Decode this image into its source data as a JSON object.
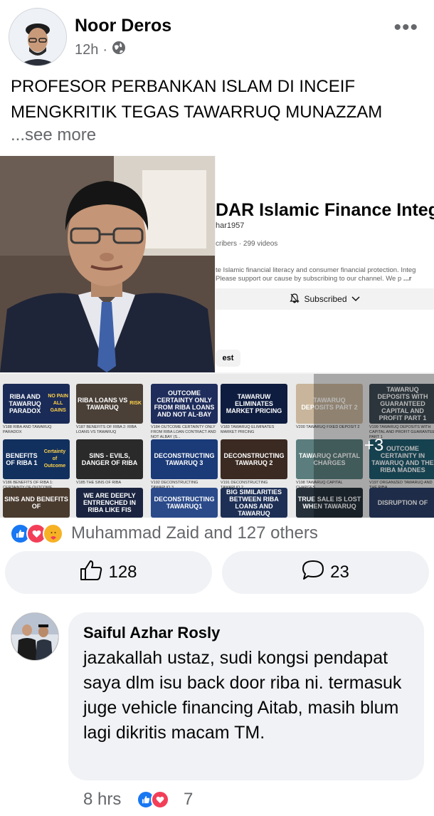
{
  "post": {
    "author": "Noor Deros",
    "time": "12h",
    "separator": "·",
    "more": "•••",
    "text": "PROFESOR PERBANKAN ISLAM DI INCEIF MENGKRITIK TEGAS TAWARRUQ MUNAZZAM",
    "see_more": "...see more"
  },
  "media": {
    "channel_title": "DAR Islamic Finance Integ",
    "channel_handle": "har1957",
    "channel_stats": "cribers · 299 videos",
    "channel_desc_1": "te Islamic financial literacy and consumer financial protection. Integ",
    "channel_desc_2": "Please support our cause by subscribing to our channel. We p",
    "channel_desc_more": "...r",
    "subscribed_label": "Subscribed",
    "chip_label": "est",
    "more_count": "+3",
    "thumbs": [
      {
        "title": "RIBA AND TAWARUQ PARADOX",
        "sub": "NO PAIN ALL GAINS",
        "caption": "V188 RIBA AND TAWARUQ PARADOX",
        "color": "#1b2b57"
      },
      {
        "title": "RIBA LOANS VS TAWARUQ",
        "sub": "RISK",
        "caption": "V187 BENEFITS OF RIBA 2: RIBA LOANS VS TAWARUQ",
        "color": "#4a4038"
      },
      {
        "title": "OUTCOME CERTAINTY ONLY FROM RIBA LOANS AND NOT AL-BAY",
        "sub": "",
        "caption": "V184 OUTCOME CERTAINTY ONLY FROM RIBA LOAN CONTRACT AND NOT ALBAY (S...",
        "color": "#1f2d5c"
      },
      {
        "title": "TAWARUW ELIMINATES MARKET PRICING",
        "sub": "",
        "caption": "V183 TAWARUQ ELIMINATES MARKET PRICING",
        "color": "#0e1c3f"
      },
      {
        "title": "TAWARUQ DEPOSITS PART 2",
        "sub": "",
        "caption": "V200 TAWARUQ FIXED DEPOSIT 2",
        "color": "#c8b59b"
      },
      {
        "title": "TAWARUQ DEPOSITS WITH GUARANTEED CAPITAL AND PROFIT PART 1",
        "sub": "",
        "caption": "V199 TAWARUQ DEPOSITS WITH CAPITAL AND PROFIT GUARANTEE PART 1",
        "color": "#3d4a52"
      },
      {
        "title": "BENEFITS OF RIBA 1",
        "sub": "Certainty of Outcome",
        "caption": "V186 BENEFITS OF RIBA 1: CERTAINTY OF OUTCOME",
        "color": "#12305e"
      },
      {
        "title": "SINS - EVILS, DANGER OF RIBA",
        "sub": "",
        "caption": "V185 THE SINS OF RIBA",
        "color": "#2a2a2a"
      },
      {
        "title": "DECONSTRUCTING TAWARUQ 3",
        "sub": "",
        "caption": "V192 DECONSTRUCTING TAWARUQ 3",
        "color": "#1b3a78"
      },
      {
        "title": "DECONSTRUCTING TAWARUQ 2",
        "sub": "",
        "caption": "V191 DECONSTRUCTING TAWARUQ 2",
        "color": "#3b2a22"
      },
      {
        "title": "TAWARUQ CAPITAL CHARGES",
        "sub": "",
        "caption": "V198 TAWARUQ CAPITAL CHARGES",
        "color": "#5b7d7d"
      },
      {
        "title": "OUTCOME CERTAINTY IN TAWARUQ AND THE RIBA MADNES",
        "sub": "",
        "caption": "V197 ORGANIZED TAWARUQ AND THE RIBA",
        "color": "#1f5a6e"
      },
      {
        "title": "SINS AND BENEFITS OF",
        "sub": "",
        "caption": "",
        "color": "#4a3b2f"
      },
      {
        "title": "WE ARE DEEPLY ENTRENCHED IN RIBA LIKE FIS",
        "sub": "",
        "caption": "",
        "color": "#1a2440"
      },
      {
        "title": "DECONSTRUCTING TAWARUQ1",
        "sub": "",
        "caption": "",
        "color": "#2a4a8a"
      },
      {
        "title": "BIG SIMILARITIES BETWEEN RIBA LOANS AND TAWARUQ",
        "sub": "",
        "caption": "",
        "color": "#1d2f55"
      },
      {
        "title": "TRUE SALE IS LOST WHEN TAWARUQ",
        "sub": "",
        "caption": "",
        "color": "#25303a"
      },
      {
        "title": "DISRUPTION OF",
        "sub": "",
        "caption": "",
        "color": "#2a3d66"
      }
    ]
  },
  "reactions": {
    "summary": "Muhammad Zaid and 127 others",
    "icons": [
      "like-icon",
      "love-icon",
      "care-icon"
    ],
    "colors": {
      "like": "#1877f2",
      "love": "#f33e58",
      "care": "#f7b125"
    }
  },
  "actions": {
    "like_count": "128",
    "comment_count": "23"
  },
  "comment": {
    "author": "Saiful Azhar Rosly",
    "text": "jazakallah ustaz, sudi kongsi pendapat saya dlm isu back door riba ni. termasuk juge vehicle financing Aitab, masih blum lagi dikritis macam TM.",
    "time": "8 hrs",
    "reaction_count": "7"
  }
}
